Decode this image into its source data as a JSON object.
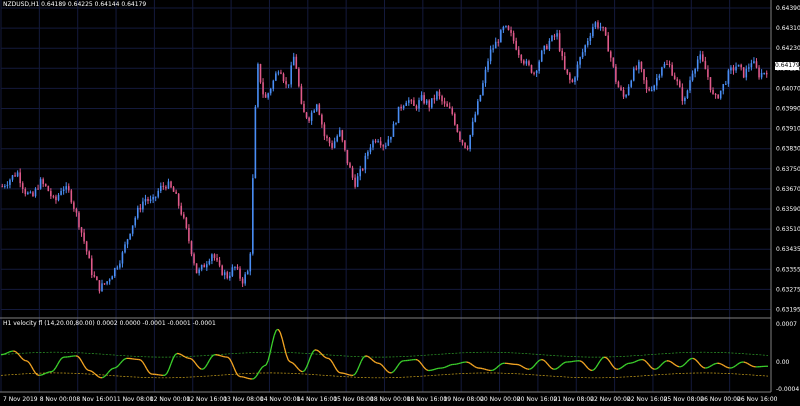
{
  "chart_title": "NZDUSD,H1  0.64189 0.64225 0.64144 0.64179",
  "indicator_title": "H1 velocity fl (14,20.00,80.00) 0.0002 0.0000 -0.0001 -0.0001 -0.0001",
  "current_price": "0.64179",
  "price_axis": [
    "0.64390",
    "0.64310",
    "0.64230",
    "0.64150",
    "0.64070",
    "0.63990",
    "0.63910",
    "0.63830",
    "0.63750",
    "0.63670",
    "0.63590",
    "0.63510",
    "0.63435",
    "0.63355",
    "0.63275",
    "0.63195"
  ],
  "indicator_axis": [
    "0.0007",
    "0.00",
    "-0.0004"
  ],
  "time_axis": [
    "7 Nov 2019",
    "8 Nov 00:00",
    "8 Nov 16:00",
    "11 Nov 08:00",
    "12 Nov 00:00",
    "12 Nov 16:00",
    "13 Nov 08:00",
    "14 Nov 00:00",
    "14 Nov 16:00",
    "15 Nov 08:00",
    "18 Nov 00:00",
    "18 Nov 16:00",
    "19 Nov 08:00",
    "20 Nov 00:00",
    "20 Nov 16:00",
    "21 Nov 08:00",
    "22 Nov 00:00",
    "22 Nov 16:00",
    "25 Nov 08:00",
    "26 Nov 00:00",
    "26 Nov 16:00"
  ],
  "colors": {
    "background": "#000000",
    "grid": "#141a3c",
    "bull": "#4a8ef5",
    "bear": "#e05a8a",
    "osc_up": "#3cd12c",
    "osc_down": "#f5a623",
    "band": "#c8a01a",
    "band2": "#2f9e2a"
  },
  "chart_data": {
    "type": "candlestick",
    "price_range": [
      0.6316,
      0.6445
    ],
    "close_path": [
      0.6369,
      0.6372,
      0.6375,
      0.6367,
      0.6364,
      0.6371,
      0.6368,
      0.6362,
      0.6369,
      0.6366,
      0.6356,
      0.6345,
      0.6332,
      0.6326,
      0.6329,
      0.6334,
      0.634,
      0.635,
      0.6358,
      0.6364,
      0.6362,
      0.6368,
      0.637,
      0.6366,
      0.6357,
      0.6345,
      0.6332,
      0.6336,
      0.6341,
      0.6334,
      0.6331,
      0.6335,
      0.6329,
      0.6334,
      0.6421,
      0.6405,
      0.6412,
      0.642,
      0.641,
      0.6425,
      0.64,
      0.6398,
      0.6405,
      0.639,
      0.6386,
      0.6392,
      0.638,
      0.637,
      0.6376,
      0.6386,
      0.639,
      0.6386,
      0.6392,
      0.6402,
      0.6406,
      0.6402,
      0.6406,
      0.6403,
      0.6408,
      0.6403,
      0.64,
      0.639,
      0.6385,
      0.6398,
      0.641,
      0.6425,
      0.643,
      0.6436,
      0.6432,
      0.6425,
      0.642,
      0.6417,
      0.6425,
      0.643,
      0.6433,
      0.6418,
      0.6412,
      0.6422,
      0.643,
      0.6438,
      0.6436,
      0.6426,
      0.6412,
      0.6406,
      0.6416,
      0.642,
      0.6409,
      0.6412,
      0.642,
      0.642,
      0.6413,
      0.6404,
      0.6417,
      0.6424,
      0.6417,
      0.6405,
      0.641,
      0.6417,
      0.642,
      0.6416,
      0.6422,
      0.6416,
      0.64179
    ],
    "oscillator": [
      0.00018,
      0.00024,
      8e-05,
      -0.00016,
      -0.0001,
      0.00014,
      0.00016,
      -8e-05,
      -0.0002,
      -4e-05,
      0.00012,
      0.0001,
      -0.00014,
      -0.00016,
      0.0002,
      0.00012,
      -6e-05,
      0.00018,
      0.00014,
      -0.00018,
      -0.00022,
      0.0,
      0.0006,
      6e-05,
      -0.0001,
      0.00026,
      0.00012,
      -0.00012,
      -0.00016,
      0.00016,
      4e-05,
      -0.00012,
      8e-05,
      0.0001,
      -8e-05,
      -4e-05,
      2e-05,
      6e-05,
      -4e-05,
      -8e-05,
      4e-05,
      2e-05,
      -6e-05,
      0.0001,
      -6e-05,
      6e-05,
      8e-05,
      -8e-05,
      0.00014,
      -6e-05,
      4e-05,
      0.0001,
      -6e-05,
      8e-05,
      -2e-05,
      0.00012,
      -4e-05,
      4e-05,
      -4e-05,
      6e-05,
      -2e-05,
      -1e-05
    ]
  }
}
